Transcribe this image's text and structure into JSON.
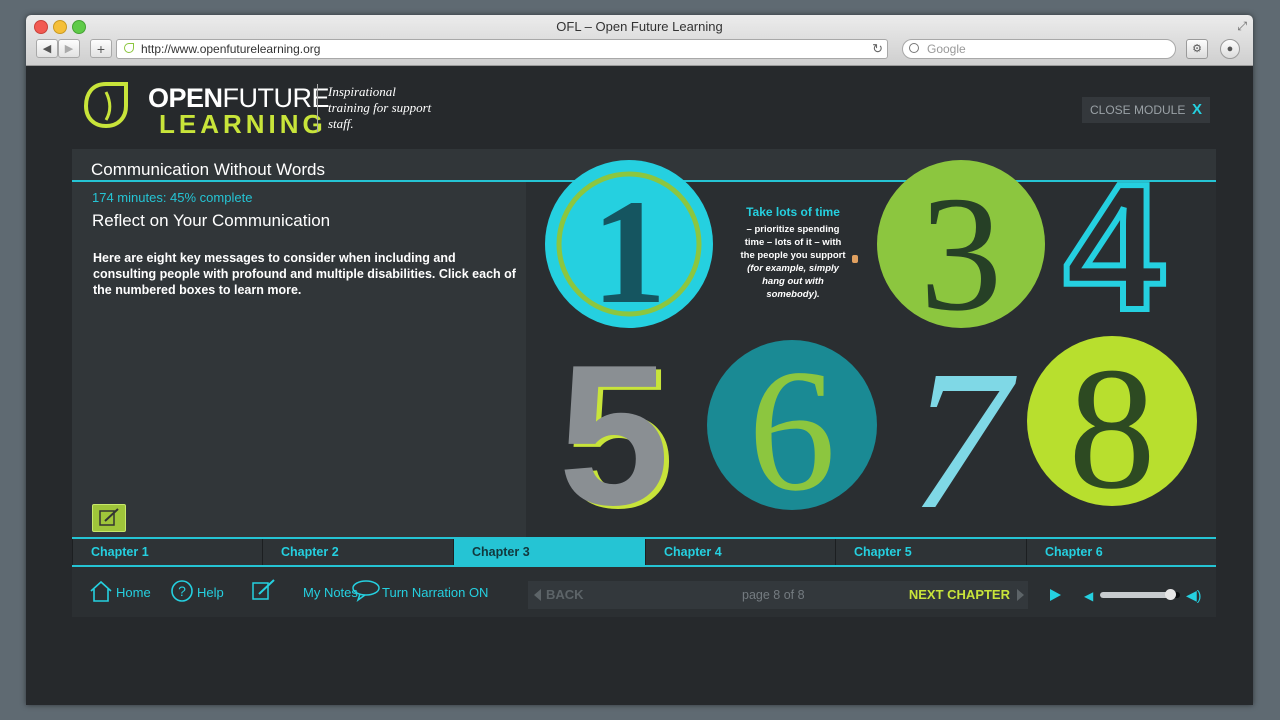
{
  "browser": {
    "title": "OFL – Open Future Learning",
    "url": "http://www.openfuturelearning.org",
    "search_placeholder": "Google",
    "back_icon": "arrow-left-icon",
    "forward_icon": "arrow-right-icon",
    "add_tab_icon": "plus-icon",
    "reload_icon": "reload-icon"
  },
  "logo": {
    "line1_a": "OPEN",
    "line1_b": "FUTURE",
    "line2": "LEARNING",
    "tagline": "Inspirational training for support staff."
  },
  "close_module": {
    "label": "CLOSE MODULE",
    "icon": "X"
  },
  "module": {
    "title": "Communication Without Words",
    "progress": "174 minutes: 45% complete",
    "progress_percent": 45,
    "section_title": "Reflect on Your Communication",
    "body": "Here are eight key messages to consider when including and consulting people with profound and multiple disabilities. Click each of the numbered boxes to learn more."
  },
  "numbers": [
    "1",
    "3",
    "4",
    "5",
    "6",
    "7",
    "8"
  ],
  "tip": {
    "heading": "Take lots of time",
    "text": "– prioritize spending time – lots of it – with the people you support",
    "example": "(for example, simply hang out with somebody)."
  },
  "chapters": [
    "Chapter 1",
    "Chapter 2",
    "Chapter 3",
    "Chapter 4",
    "Chapter 5",
    "Chapter 6"
  ],
  "active_chapter": 2,
  "footer": {
    "home": "Home",
    "help": "Help",
    "notes": "My Notes",
    "narration": "Turn Narration ON",
    "back": "BACK",
    "page": "page 8 of 8",
    "next": "NEXT CHAPTER",
    "volume_level": 0.88
  },
  "colors": {
    "accent_cyan": "#25c4d4",
    "accent_green": "#c8e43a",
    "background": "#26292c"
  }
}
